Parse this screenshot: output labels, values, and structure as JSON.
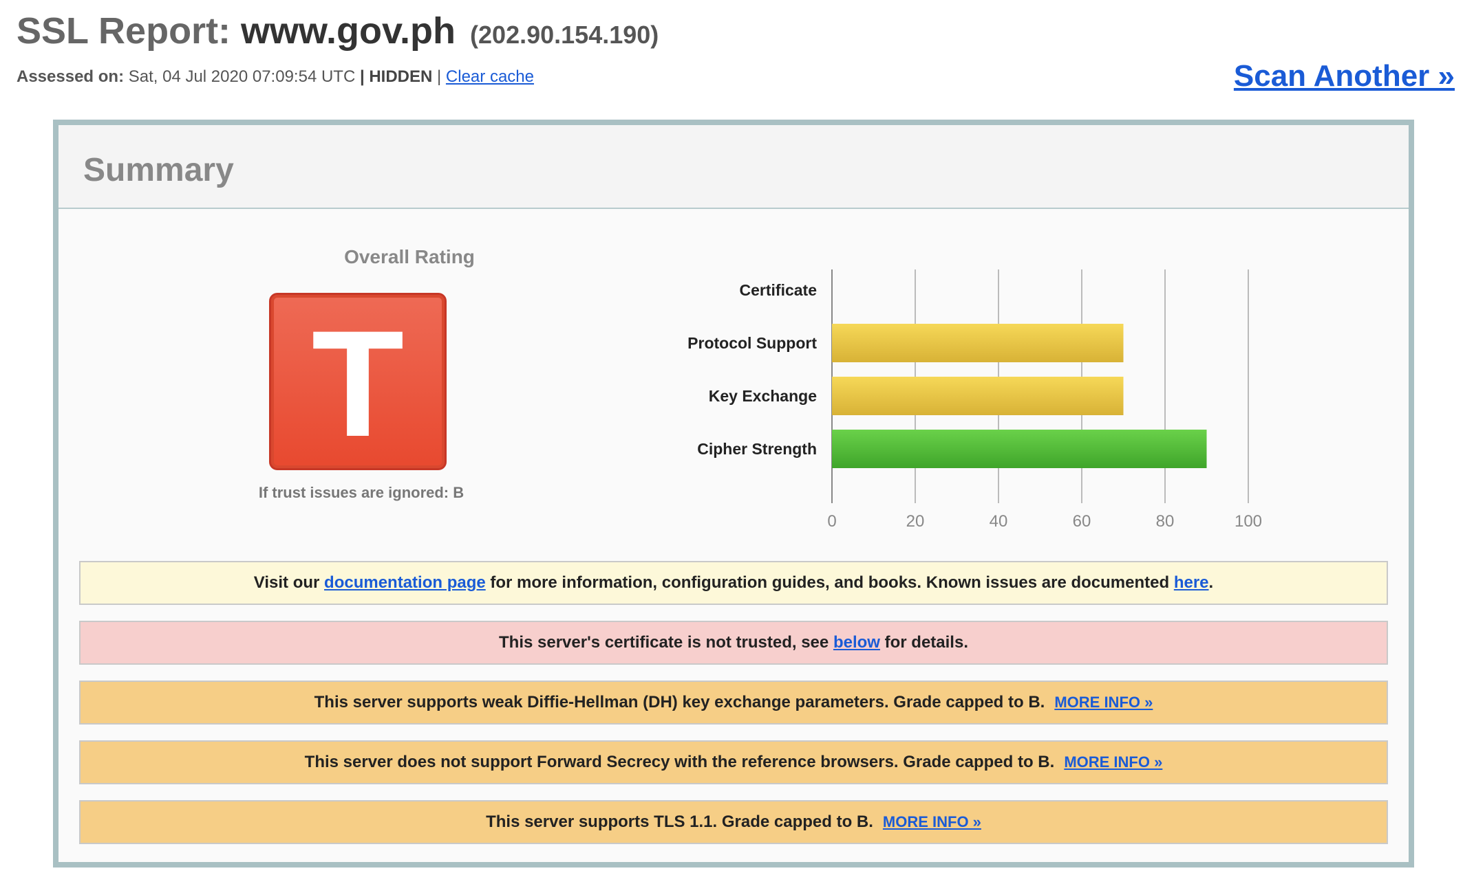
{
  "header": {
    "title_prefix": "SSL Report:",
    "host": "www.gov.ph",
    "ip": "(202.90.154.190)",
    "assessed_label": "Assessed on:",
    "assessed_value": "Sat, 04 Jul 2020 07:09:54 UTC",
    "hidden_label": "| HIDDEN",
    "separator": "|",
    "clear_cache": "Clear cache",
    "scan_another": "Scan Another »"
  },
  "summary": {
    "heading": "Summary",
    "rating_title": "Overall Rating",
    "grade": "T",
    "grade_note": "If trust issues are ignored: B",
    "colors": {
      "grade_red": "#e8492f",
      "bar_yellow": "#e8c23c",
      "bar_green": "#4db533",
      "link_blue": "#1a5bd6"
    }
  },
  "chart_data": {
    "type": "bar",
    "orientation": "horizontal",
    "categories": [
      "Certificate",
      "Protocol Support",
      "Key Exchange",
      "Cipher Strength"
    ],
    "values": [
      0,
      70,
      70,
      90
    ],
    "bar_colors": [
      "none",
      "yellow",
      "yellow",
      "green"
    ],
    "xlim": [
      0,
      100
    ],
    "xticks": [
      "0",
      "20",
      "40",
      "60",
      "80",
      "100"
    ],
    "grid": true
  },
  "notices": [
    {
      "style": "yellow",
      "text_a": "Visit our ",
      "link_a": "documentation page",
      "text_b": " for more information, configuration guides, and books. Known issues are documented ",
      "link_b": "here",
      "text_c": "."
    },
    {
      "style": "pink",
      "text_a": "This server's certificate is not trusted, see ",
      "link_a": "below",
      "text_b": " for details."
    },
    {
      "style": "orange",
      "text": "This server supports weak Diffie-Hellman (DH) key exchange parameters. Grade capped to B.",
      "more": "MORE INFO »"
    },
    {
      "style": "orange",
      "text": "This server does not support Forward Secrecy with the reference browsers. Grade capped to B.",
      "more": "MORE INFO »"
    },
    {
      "style": "orange",
      "text": "This server supports TLS 1.1. Grade capped to B.",
      "more": "MORE INFO »"
    }
  ]
}
